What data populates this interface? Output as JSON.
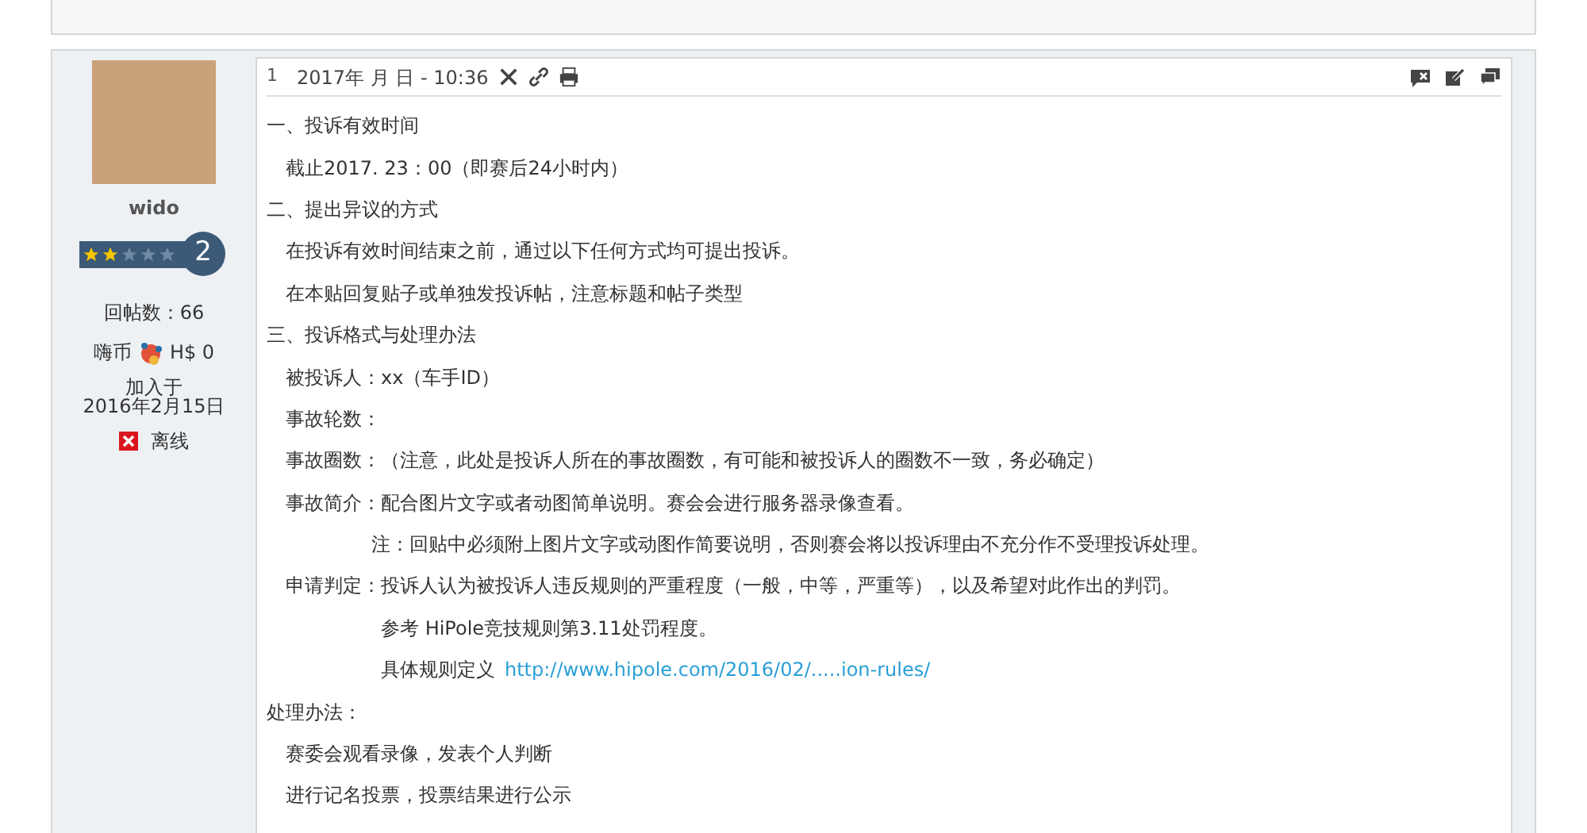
{
  "post": {
    "author": {
      "name": "wido",
      "stars": 2,
      "rank": "2",
      "reply_count": "回帖数：66",
      "coin_label": "嗨币",
      "coin_value": "H$ 0",
      "joined_label": "加入于",
      "joined_date": "2016年2月15日",
      "status": "离线",
      "online": false
    },
    "number": "1",
    "date": "2017年 月 日 - 10:36",
    "lines": [
      {
        "kind": "heading",
        "text": "一、投诉有效时间"
      },
      {
        "kind": "item",
        "text": "截止2017.      23：00（即赛后24小时内）"
      },
      {
        "kind": "heading",
        "text": "二、提出异议的方式"
      },
      {
        "kind": "item",
        "text": "在投诉有效时间结束之前，通过以下任何方式均可提出投诉。"
      },
      {
        "kind": "item",
        "text": "在本贴回复贴子或单独发投诉帖，注意标题和帖子类型"
      },
      {
        "kind": "heading",
        "text": "三、投诉格式与处理办法"
      },
      {
        "kind": "item",
        "text": "被投诉人：xx（车手ID）"
      },
      {
        "kind": "item",
        "text": "事故轮数："
      },
      {
        "kind": "item",
        "text": "事故圈数：（注意，此处是投诉人所在的事故圈数，有可能和被投诉人的圈数不一致，务必确定）"
      },
      {
        "kind": "item",
        "text": "事故简介：配合图片文字或者动图简单说明。赛会会进行服务器录像查看。"
      },
      {
        "kind": "note",
        "text": "注：回贴中必须附上图片文字或动图作简要说明，否则赛会将以投诉理由不充分作不受理投诉处理。"
      },
      {
        "kind": "item",
        "text": "申请判定：投诉人认为被投诉人违反规则的严重程度（一般，中等，严重等），以及希望对此作出的判罚。"
      },
      {
        "kind": "sub",
        "text": "参考 HiPole竞技规则第3.11处罚程度。"
      },
      {
        "kind": "link",
        "text": "具体规则定义",
        "link": "http://www.hipole.com/2016/02/.....ion-rules/"
      },
      {
        "kind": "heading",
        "text": "处理办法："
      },
      {
        "kind": "item",
        "text": "赛委会观看录像，发表个人判断"
      },
      {
        "kind": "item",
        "text": "进行记名投票，投票结果进行公示"
      }
    ]
  }
}
